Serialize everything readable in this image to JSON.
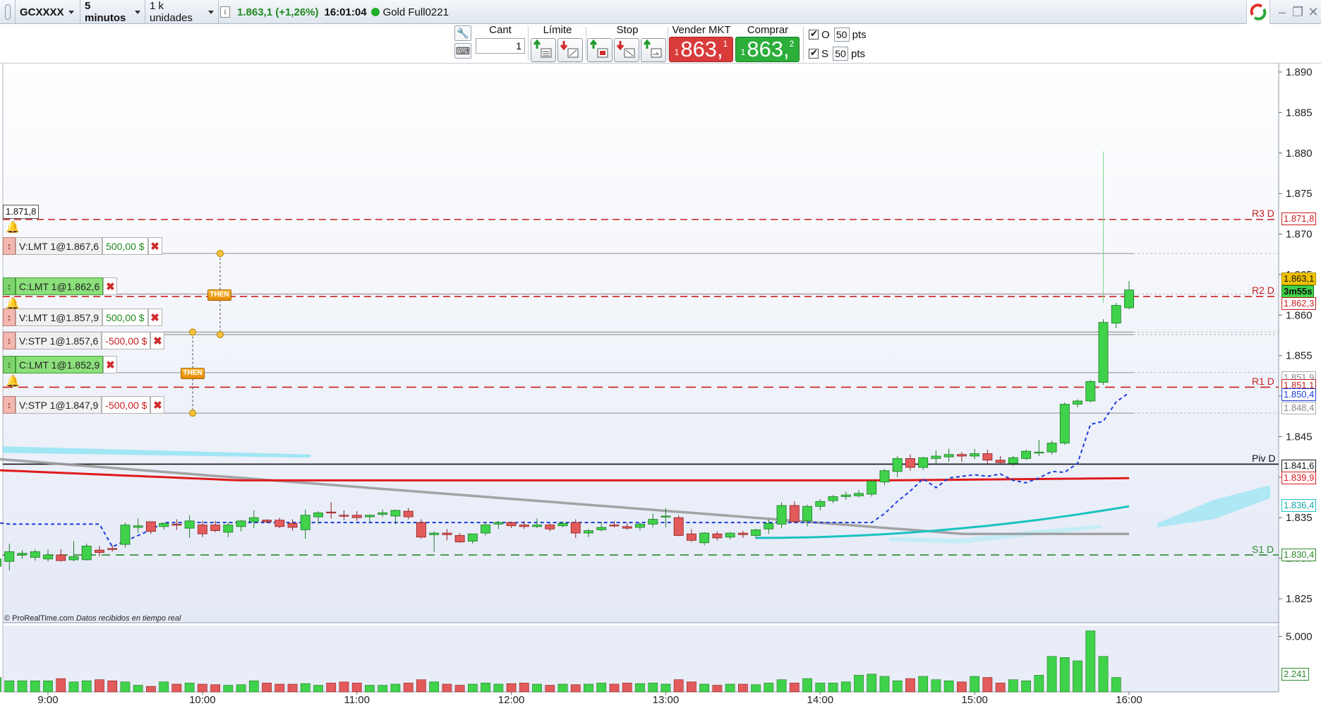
{
  "titlebar": {
    "instrument": "GCXXXX",
    "timeframe": "5 minutos",
    "units": "1 k unidades",
    "last_price": "1.863,1 (+1,26%)",
    "time": "16:01:04",
    "instrument_name": "Gold Full0221"
  },
  "tradebar": {
    "qty_label": "Cant",
    "qty_value": "1",
    "limit_label": "Límite",
    "stop_label": "Stop",
    "sell_label": "Vender MKT",
    "buy_label": "Comprar MKT",
    "sell_prefix": "1",
    "sell_price": "863,",
    "sell_sup": "1",
    "buy_prefix": "1",
    "buy_price": "863,",
    "buy_sup": "2",
    "o_label": "O",
    "o_value": "50",
    "s_label": "S",
    "s_value": "50",
    "pts": "pts"
  },
  "orders": [
    {
      "label": "V:LMT 1@1.867,6",
      "amount": "500,00 $",
      "side": "sell"
    },
    {
      "label": "C:LMT 1@1.862,6",
      "amount": "",
      "side": "buy"
    },
    {
      "label": "V:LMT 1@1.857,9",
      "amount": "500,00 $",
      "side": "sell"
    },
    {
      "label": "V:STP 1@1.857,6",
      "amount": "-500,00 $",
      "side": "sell"
    },
    {
      "label": "C:LMT 1@1.852,9",
      "amount": "",
      "side": "buy"
    },
    {
      "label": "V:STP 1@1.847,9",
      "amount": "-500,00 $",
      "side": "sell"
    }
  ],
  "then_label": "THEN",
  "left_price_box": "1.871,8",
  "credit": {
    "brand": "© ProRealTime.com",
    "note": "Datos recibidos en tiempo real"
  },
  "levels": {
    "r3": "R3 D",
    "r2": "R2 D",
    "r1": "R1 D",
    "piv": "Piv D",
    "s1": "S1 D"
  },
  "price_flags": {
    "r3": "1.871,8",
    "last": "1.863,1",
    "countdown": "3m55s",
    "r2": "1.862,3",
    "f1": "1.851,9",
    "r1": "1.851,1",
    "ma_blue": "1.850,4",
    "f2": "1.848,4",
    "piv": "1.841,6",
    "ma_red": "1.839,9",
    "ma_cyan": "1.836,4",
    "s1": "1.830,4",
    "vol_last": "2.241"
  },
  "colors": {
    "up": "#3fd24a",
    "down": "#e25a5a",
    "resistance": "#c81e1e",
    "support": "#2c8a2c",
    "ma_red": "#e01a1a",
    "ma_gray": "#9a9a9a",
    "ma_cyan": "#19c2c2",
    "ma_blue": "#1a3bdc",
    "last_flag": "#f2c200"
  },
  "chart_data": {
    "type": "candlestick",
    "instrument": "GCXXXX",
    "timeframe": "5 minutos",
    "x_ticks": [
      "9:00",
      "10:00",
      "11:00",
      "12:00",
      "13:00",
      "14:00",
      "15:00",
      "16:00"
    ],
    "y_ticks": [
      "1.890",
      "1.885",
      "1.880",
      "1.875",
      "1.870",
      "1.865",
      "1.860",
      "1.855",
      "1.850",
      "1.845",
      "1.840",
      "1.835",
      "1.830",
      "1.825"
    ],
    "ylim": [
      1822.5,
      1891
    ],
    "volume_ticks": [
      "5.000"
    ],
    "candles": [
      {
        "o": 1843.0,
        "h": 1844.0,
        "l": 1842.3,
        "c": 1843.6
      },
      {
        "o": 1843.3,
        "h": 1844.1,
        "l": 1842.2,
        "c": 1842.6
      },
      {
        "o": 1843.3,
        "h": 1843.4,
        "l": 1841.4,
        "c": 1841.8
      },
      {
        "o": 1841.8,
        "h": 1842.3,
        "l": 1840.6,
        "c": 1840.8
      },
      {
        "o": 1840.8,
        "h": 1841.0,
        "l": 1838.9,
        "c": 1840.2
      },
      {
        "o": 1840.9,
        "h": 1841.7,
        "l": 1840.3,
        "c": 1840.3
      },
      {
        "o": 1839.9,
        "h": 1840.5,
        "l": 1838.3,
        "c": 1839.1
      },
      {
        "o": 1839.3,
        "h": 1840.0,
        "l": 1838.8,
        "c": 1839.0
      },
      {
        "o": 1838.7,
        "h": 1839.0,
        "l": 1838.0,
        "c": 1838.2
      },
      {
        "o": 1838.2,
        "h": 1838.8,
        "l": 1836.9,
        "c": 1837.7
      },
      {
        "o": 1835.9,
        "h": 1836.1,
        "l": 1825.4,
        "c": 1829.2
      },
      {
        "o": 1829.0,
        "h": 1830.2,
        "l": 1827.7,
        "c": 1829.9
      },
      {
        "o": 1829.6,
        "h": 1831.8,
        "l": 1828.5,
        "c": 1830.8
      },
      {
        "o": 1830.4,
        "h": 1831.0,
        "l": 1829.9,
        "c": 1830.6
      },
      {
        "o": 1830.1,
        "h": 1831.1,
        "l": 1829.7,
        "c": 1830.8
      },
      {
        "o": 1829.9,
        "h": 1831.1,
        "l": 1829.6,
        "c": 1830.4
      },
      {
        "o": 1830.4,
        "h": 1831.1,
        "l": 1829.6,
        "c": 1829.7
      },
      {
        "o": 1829.8,
        "h": 1832.1,
        "l": 1829.6,
        "c": 1830.2
      },
      {
        "o": 1829.8,
        "h": 1831.8,
        "l": 1829.7,
        "c": 1831.5
      },
      {
        "o": 1831.0,
        "h": 1831.5,
        "l": 1830.2,
        "c": 1830.7
      },
      {
        "o": 1831.2,
        "h": 1831.6,
        "l": 1830.8,
        "c": 1831.1
      },
      {
        "o": 1831.7,
        "h": 1834.4,
        "l": 1831.3,
        "c": 1834.1
      },
      {
        "o": 1833.8,
        "h": 1834.9,
        "l": 1833.1,
        "c": 1834.0
      },
      {
        "o": 1834.5,
        "h": 1834.5,
        "l": 1833.0,
        "c": 1833.3
      },
      {
        "o": 1833.9,
        "h": 1834.4,
        "l": 1833.5,
        "c": 1834.3
      },
      {
        "o": 1834.2,
        "h": 1834.8,
        "l": 1833.5,
        "c": 1834.1
      },
      {
        "o": 1833.7,
        "h": 1835.3,
        "l": 1832.5,
        "c": 1834.6
      },
      {
        "o": 1834.1,
        "h": 1834.6,
        "l": 1832.6,
        "c": 1833.0
      },
      {
        "o": 1834.1,
        "h": 1834.6,
        "l": 1833.2,
        "c": 1833.4
      },
      {
        "o": 1833.2,
        "h": 1834.4,
        "l": 1832.6,
        "c": 1834.1
      },
      {
        "o": 1833.9,
        "h": 1834.7,
        "l": 1833.3,
        "c": 1834.6
      },
      {
        "o": 1834.5,
        "h": 1835.9,
        "l": 1833.7,
        "c": 1835.0
      },
      {
        "o": 1834.7,
        "h": 1834.8,
        "l": 1834.3,
        "c": 1834.5
      },
      {
        "o": 1834.7,
        "h": 1835.0,
        "l": 1833.7,
        "c": 1833.9
      },
      {
        "o": 1834.3,
        "h": 1834.8,
        "l": 1833.4,
        "c": 1833.8
      },
      {
        "o": 1833.5,
        "h": 1836.0,
        "l": 1832.4,
        "c": 1835.3
      },
      {
        "o": 1835.1,
        "h": 1835.8,
        "l": 1834.2,
        "c": 1835.6
      },
      {
        "o": 1835.7,
        "h": 1836.9,
        "l": 1834.9,
        "c": 1835.6
      },
      {
        "o": 1835.3,
        "h": 1835.9,
        "l": 1834.7,
        "c": 1835.2
      },
      {
        "o": 1835.3,
        "h": 1835.8,
        "l": 1834.6,
        "c": 1835.0
      },
      {
        "o": 1835.1,
        "h": 1835.4,
        "l": 1834.4,
        "c": 1835.3
      },
      {
        "o": 1835.4,
        "h": 1836.0,
        "l": 1835.1,
        "c": 1835.6
      },
      {
        "o": 1835.2,
        "h": 1836.0,
        "l": 1834.2,
        "c": 1835.9
      },
      {
        "o": 1835.8,
        "h": 1836.2,
        "l": 1834.8,
        "c": 1835.1
      },
      {
        "o": 1834.4,
        "h": 1834.8,
        "l": 1832.4,
        "c": 1832.6
      },
      {
        "o": 1832.9,
        "h": 1833.3,
        "l": 1830.8,
        "c": 1833.1
      },
      {
        "o": 1833.1,
        "h": 1833.6,
        "l": 1832.2,
        "c": 1832.9
      },
      {
        "o": 1832.8,
        "h": 1833.1,
        "l": 1831.9,
        "c": 1832.0
      },
      {
        "o": 1832.1,
        "h": 1833.0,
        "l": 1831.8,
        "c": 1833.0
      },
      {
        "o": 1833.1,
        "h": 1834.4,
        "l": 1832.8,
        "c": 1834.1
      },
      {
        "o": 1834.2,
        "h": 1834.6,
        "l": 1833.6,
        "c": 1834.4
      },
      {
        "o": 1834.4,
        "h": 1834.5,
        "l": 1833.7,
        "c": 1834.0
      },
      {
        "o": 1834.1,
        "h": 1834.6,
        "l": 1833.6,
        "c": 1833.9
      },
      {
        "o": 1833.9,
        "h": 1834.9,
        "l": 1833.7,
        "c": 1834.1
      },
      {
        "o": 1834.1,
        "h": 1834.3,
        "l": 1833.3,
        "c": 1833.6
      },
      {
        "o": 1834.0,
        "h": 1834.5,
        "l": 1833.8,
        "c": 1834.3
      },
      {
        "o": 1834.4,
        "h": 1834.8,
        "l": 1832.5,
        "c": 1833.1
      },
      {
        "o": 1833.1,
        "h": 1833.6,
        "l": 1832.6,
        "c": 1833.4
      },
      {
        "o": 1833.5,
        "h": 1834.5,
        "l": 1833.3,
        "c": 1833.8
      },
      {
        "o": 1834.1,
        "h": 1834.6,
        "l": 1833.8,
        "c": 1834.0
      },
      {
        "o": 1833.9,
        "h": 1834.3,
        "l": 1833.5,
        "c": 1833.7
      },
      {
        "o": 1833.8,
        "h": 1834.4,
        "l": 1833.4,
        "c": 1834.2
      },
      {
        "o": 1834.2,
        "h": 1835.5,
        "l": 1833.8,
        "c": 1834.8
      },
      {
        "o": 1835.2,
        "h": 1836.2,
        "l": 1833.8,
        "c": 1835.2
      },
      {
        "o": 1835.0,
        "h": 1835.3,
        "l": 1832.7,
        "c": 1832.8
      },
      {
        "o": 1833.0,
        "h": 1833.6,
        "l": 1832.0,
        "c": 1832.2
      },
      {
        "o": 1831.9,
        "h": 1833.2,
        "l": 1831.6,
        "c": 1833.1
      },
      {
        "o": 1833.0,
        "h": 1833.3,
        "l": 1832.2,
        "c": 1832.5
      },
      {
        "o": 1832.6,
        "h": 1833.2,
        "l": 1832.3,
        "c": 1833.1
      },
      {
        "o": 1833.1,
        "h": 1833.4,
        "l": 1832.5,
        "c": 1832.9
      },
      {
        "o": 1832.8,
        "h": 1833.6,
        "l": 1832.4,
        "c": 1833.5
      },
      {
        "o": 1833.6,
        "h": 1834.8,
        "l": 1833.0,
        "c": 1834.3
      },
      {
        "o": 1834.2,
        "h": 1836.9,
        "l": 1833.7,
        "c": 1836.5
      },
      {
        "o": 1836.5,
        "h": 1837.0,
        "l": 1834.3,
        "c": 1834.5
      },
      {
        "o": 1834.6,
        "h": 1836.6,
        "l": 1833.9,
        "c": 1836.4
      },
      {
        "o": 1836.4,
        "h": 1837.3,
        "l": 1835.9,
        "c": 1837.0
      },
      {
        "o": 1837.1,
        "h": 1837.8,
        "l": 1836.8,
        "c": 1837.6
      },
      {
        "o": 1837.6,
        "h": 1838.2,
        "l": 1837.2,
        "c": 1837.8
      },
      {
        "o": 1837.7,
        "h": 1838.4,
        "l": 1837.5,
        "c": 1838.0
      },
      {
        "o": 1837.9,
        "h": 1839.6,
        "l": 1837.6,
        "c": 1839.5
      },
      {
        "o": 1839.4,
        "h": 1841.0,
        "l": 1839.0,
        "c": 1840.8
      },
      {
        "o": 1840.7,
        "h": 1842.6,
        "l": 1840.0,
        "c": 1842.3
      },
      {
        "o": 1842.3,
        "h": 1842.8,
        "l": 1840.8,
        "c": 1841.2
      },
      {
        "o": 1841.2,
        "h": 1842.5,
        "l": 1840.9,
        "c": 1842.4
      },
      {
        "o": 1842.3,
        "h": 1843.3,
        "l": 1841.7,
        "c": 1842.6
      },
      {
        "o": 1842.5,
        "h": 1843.5,
        "l": 1841.9,
        "c": 1842.8
      },
      {
        "o": 1842.8,
        "h": 1843.1,
        "l": 1841.9,
        "c": 1842.6
      },
      {
        "o": 1842.6,
        "h": 1843.5,
        "l": 1842.2,
        "c": 1842.9
      },
      {
        "o": 1842.9,
        "h": 1843.4,
        "l": 1841.6,
        "c": 1842.1
      },
      {
        "o": 1842.1,
        "h": 1842.6,
        "l": 1841.5,
        "c": 1841.8
      },
      {
        "o": 1841.7,
        "h": 1842.6,
        "l": 1841.4,
        "c": 1842.4
      },
      {
        "o": 1842.3,
        "h": 1843.4,
        "l": 1842.1,
        "c": 1843.2
      },
      {
        "o": 1843.1,
        "h": 1844.6,
        "l": 1842.6,
        "c": 1843.1
      },
      {
        "o": 1843.1,
        "h": 1844.5,
        "l": 1842.8,
        "c": 1844.2
      },
      {
        "o": 1844.2,
        "h": 1849.2,
        "l": 1844.0,
        "c": 1849.0
      },
      {
        "o": 1849.0,
        "h": 1849.6,
        "l": 1848.6,
        "c": 1849.4
      },
      {
        "o": 1849.4,
        "h": 1852.0,
        "l": 1849.2,
        "c": 1851.8
      },
      {
        "o": 1851.7,
        "h": 1859.5,
        "l": 1851.4,
        "c": 1859.1
      },
      {
        "o": 1859.0,
        "h": 1861.5,
        "l": 1858.4,
        "c": 1861.2
      },
      {
        "o": 1860.9,
        "h": 1864.2,
        "l": 1860.7,
        "c": 1863.1
      }
    ],
    "volumes": [
      600,
      1100,
      1000,
      1000,
      850,
      900,
      1000,
      950,
      750,
      3800,
      1700,
      1300,
      1000,
      1000,
      1000,
      1000,
      1200,
      900,
      1000,
      1100,
      1000,
      900,
      600,
      500,
      900,
      700,
      800,
      700,
      650,
      600,
      650,
      1000,
      800,
      700,
      700,
      750,
      600,
      800,
      900,
      800,
      600,
      600,
      700,
      800,
      1100,
      900,
      700,
      600,
      700,
      800,
      700,
      750,
      800,
      700,
      600,
      700,
      650,
      700,
      800,
      700,
      800,
      750,
      800,
      700,
      1100,
      900,
      700,
      600,
      700,
      700,
      650,
      800,
      1100,
      800,
      1200,
      800,
      800,
      900,
      1500,
      1600,
      1400,
      1000,
      1200,
      1400,
      1100,
      1000,
      900,
      1400,
      1300,
      800,
      1100,
      1000,
      1500,
      3200,
      3100,
      2800,
      5500,
      3200,
      1300
    ],
    "overlays": {
      "ma_red": [
        1839.7,
        1839.9
      ],
      "ma_gray": [
        1843.5,
        1833.0
      ],
      "ma_blue_last": 1850.4,
      "ma_cyan_last": 1836.4
    },
    "levels": [
      {
        "name": "R3 D",
        "value": 1871.8
      },
      {
        "name": "R2 D",
        "value": 1862.3
      },
      {
        "name": "R1 D",
        "value": 1851.1
      },
      {
        "name": "Piv D",
        "value": 1841.6
      },
      {
        "name": "S1 D",
        "value": 1830.4
      }
    ],
    "order_levels": [
      1867.6,
      1862.6,
      1857.9,
      1857.6,
      1852.9,
      1847.9
    ]
  }
}
